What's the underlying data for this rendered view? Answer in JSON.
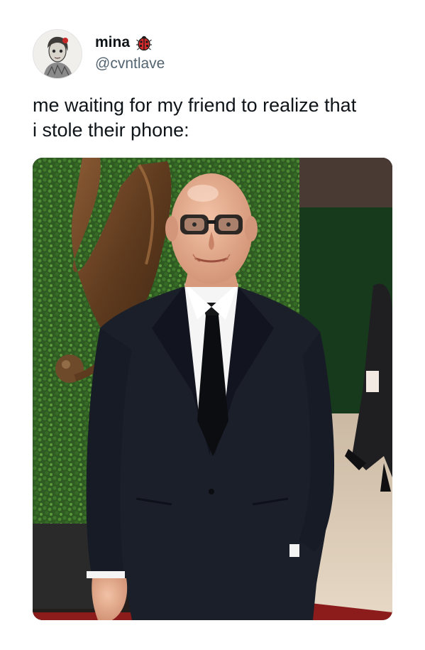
{
  "tweet": {
    "author": {
      "display_name": "mina",
      "handle": "@cvntlave",
      "badge_icon": "ladybug-icon",
      "avatar_icon": "portrait-sketch-avatar"
    },
    "text_lines": [
      "me waiting for my friend to realize that",
      "i stole their phone:"
    ],
    "media": {
      "type": "photo",
      "icon": "photo-man-in-black-suit-glasses"
    }
  },
  "colors": {
    "text_primary": "#0f1419",
    "text_secondary": "#536471",
    "background": "#ffffff",
    "badge_red": "#d62b2b"
  }
}
